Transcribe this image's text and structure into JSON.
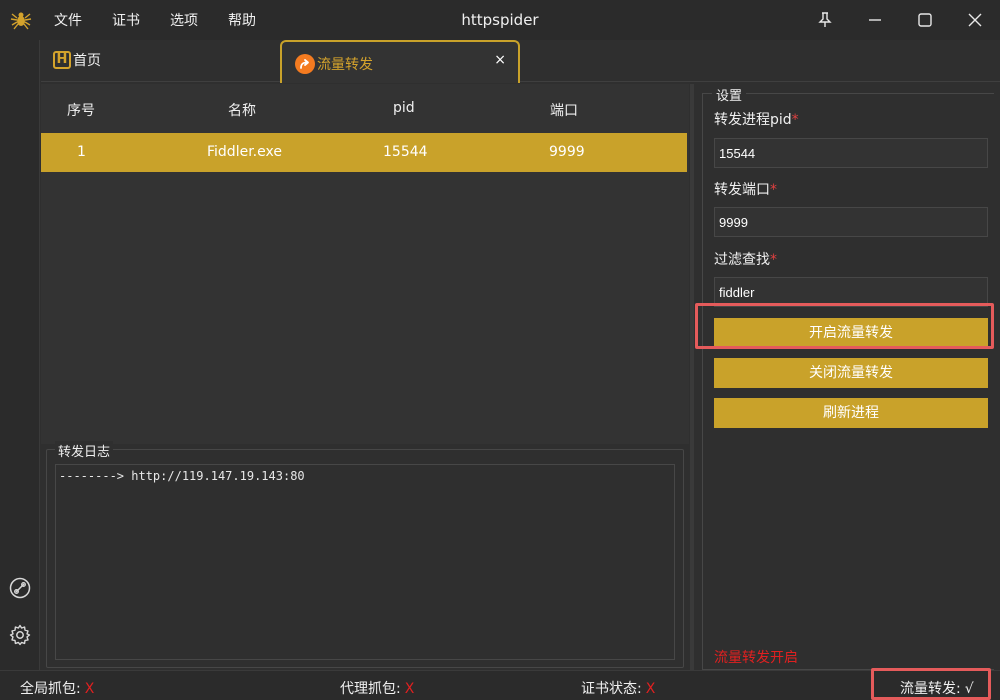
{
  "app": {
    "title": "httpspider",
    "menu": [
      "文件",
      "证书",
      "选项",
      "帮助"
    ]
  },
  "tabs": {
    "home_label": "首页",
    "home_badge": "H",
    "active_label": "流量转发",
    "close_glyph": "×"
  },
  "table": {
    "columns": [
      "序号",
      "名称",
      "pid",
      "端口"
    ],
    "rows": [
      {
        "index": "1",
        "name": "Fiddler.exe",
        "pid": "15544",
        "port": "9999"
      }
    ]
  },
  "log": {
    "title": "转发日志",
    "lines": [
      "--------> http://119.147.19.143:80"
    ]
  },
  "settings": {
    "title": "设置",
    "pid_label": "转发进程pid",
    "pid_value": "15544",
    "port_label": "转发端口",
    "port_value": "9999",
    "filter_label": "过滤查找",
    "filter_value": "fiddler",
    "required_mark": "*",
    "start_button": "开启流量转发",
    "stop_button": "关闭流量转发",
    "refresh_button": "刷新进程",
    "status_message": "流量转发开启"
  },
  "statusbar": {
    "global_capture_label": "全局抓包:",
    "global_capture_value": "X",
    "proxy_capture_label": "代理抓包:",
    "proxy_capture_value": "X",
    "cert_status_label": "证书状态:",
    "cert_status_value": "X",
    "forward_label": "流量转发:",
    "forward_value": "√"
  },
  "colors": {
    "accent": "#c9a22a",
    "error": "#e02020",
    "highlight": "#e55b5b",
    "tab_icon": "#f47b20"
  }
}
